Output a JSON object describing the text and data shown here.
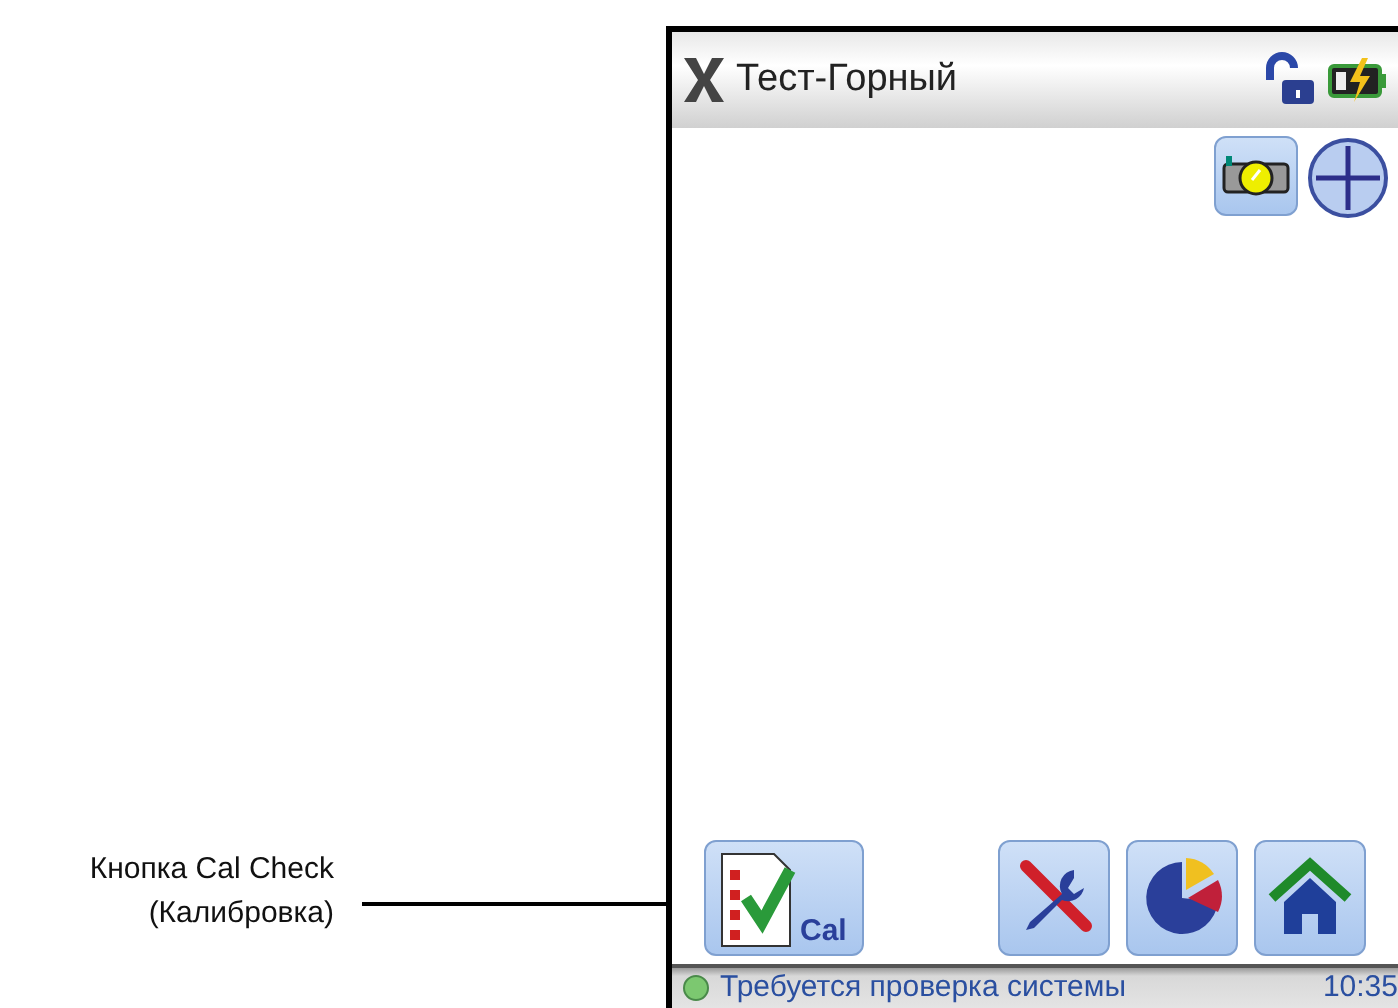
{
  "callout": {
    "lines": [
      "Кнопка Cal Check",
      "(Калибровка)"
    ]
  },
  "device": {
    "title": "Тест-Горный",
    "bottom_buttons": [
      {
        "kind": "cal",
        "label": "Cal"
      },
      {
        "kind": "tools"
      },
      {
        "kind": "chart"
      },
      {
        "kind": "home"
      }
    ],
    "status_bar": {
      "message": "Требуется проверка системы",
      "time": "10:35"
    }
  }
}
